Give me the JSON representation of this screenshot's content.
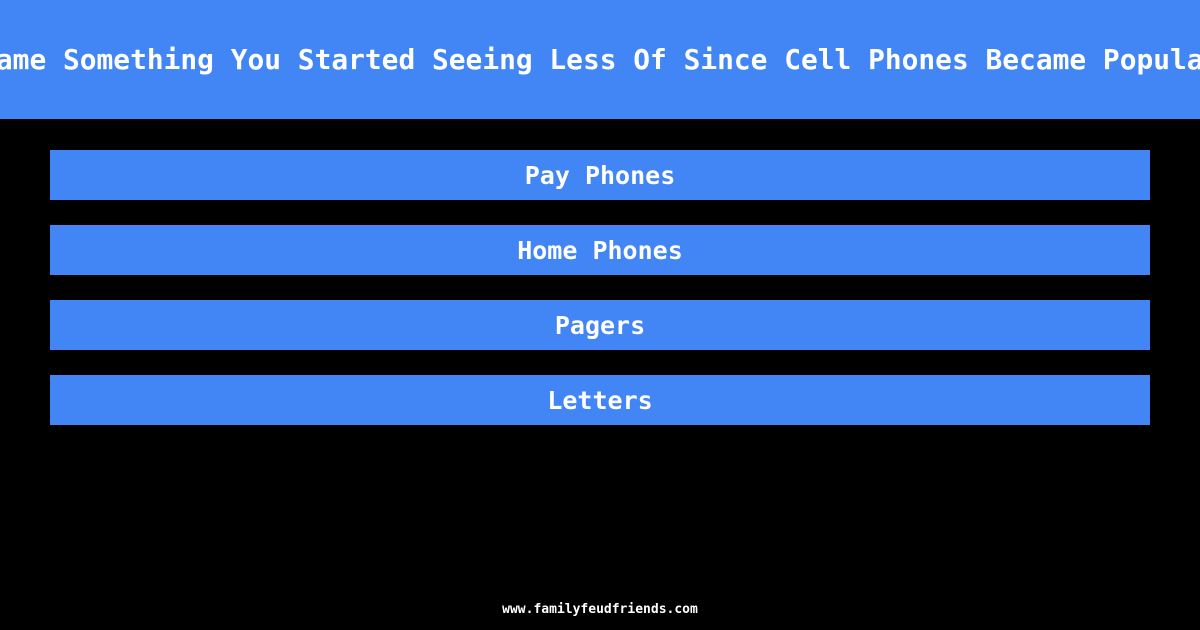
{
  "header": {
    "question": "Name Something You Started Seeing Less Of Since Cell Phones Became Popular",
    "background_color": "#4285f4",
    "text_color": "#ffffff"
  },
  "board": {
    "background_color": "#000000",
    "answers": [
      {
        "label": "Pay Phones"
      },
      {
        "label": "Home Phones"
      },
      {
        "label": "Pagers"
      },
      {
        "label": "Letters"
      }
    ]
  },
  "footer": {
    "site": "www.familyfeudfriends.com"
  }
}
